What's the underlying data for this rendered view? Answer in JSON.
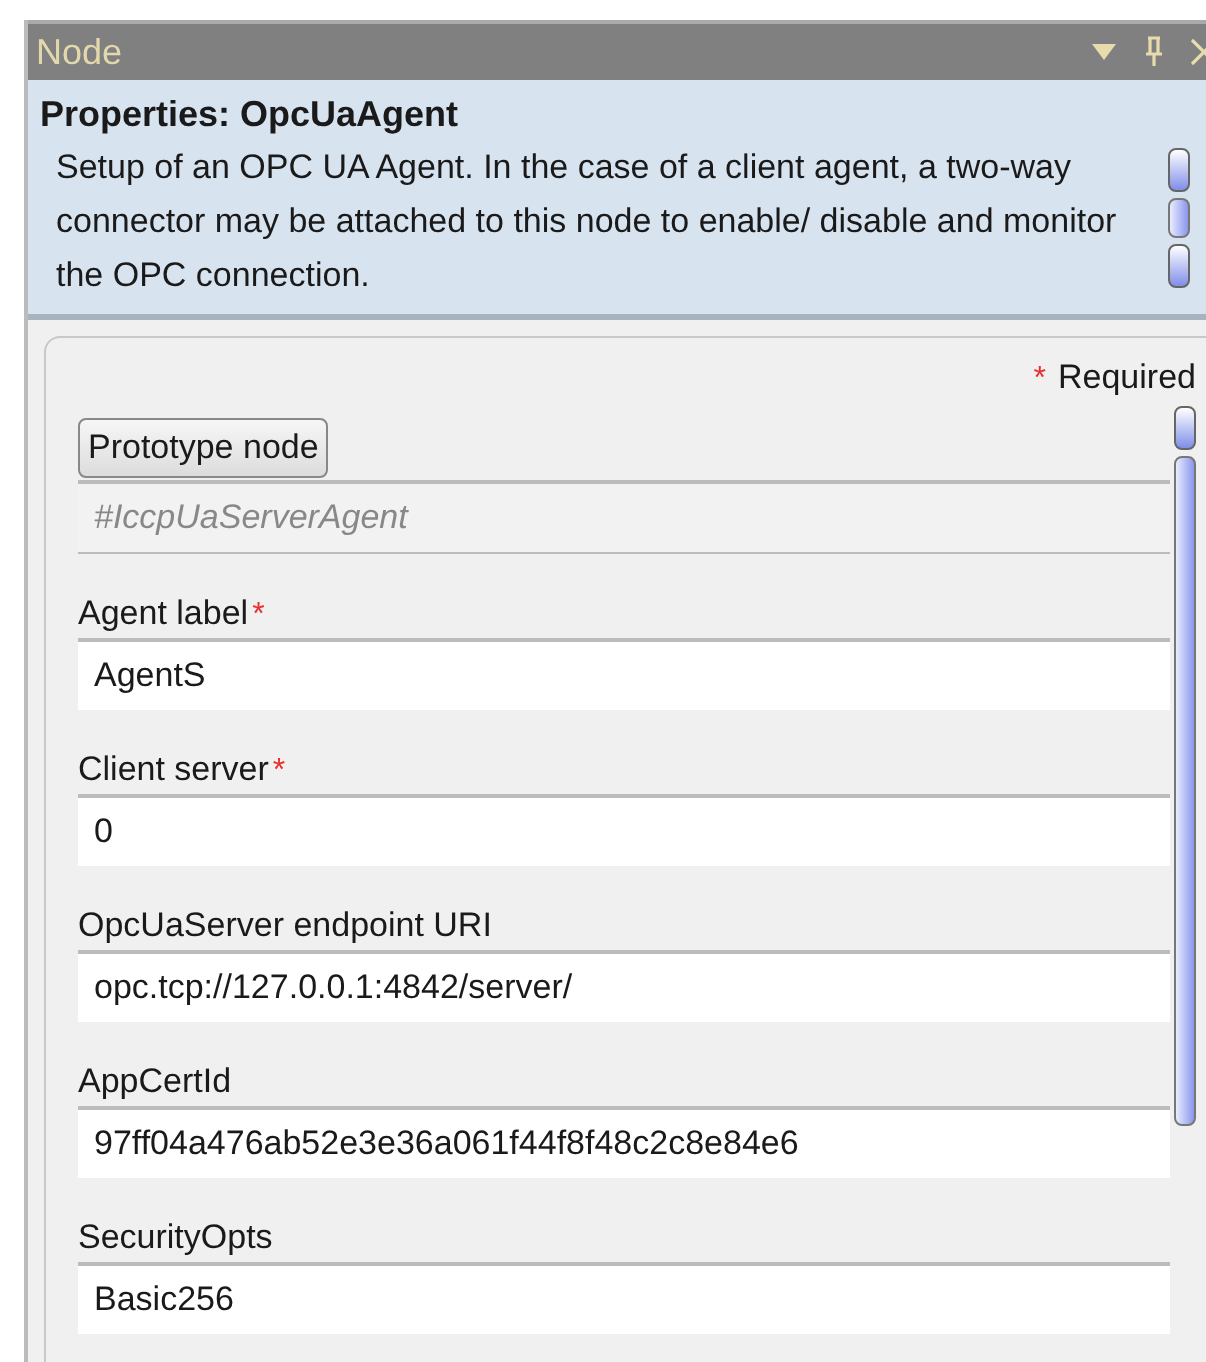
{
  "window": {
    "title": "Node"
  },
  "header": {
    "title": "Properties:  OpcUaAgent",
    "description": "Setup of an OPC UA Agent. In the case of a client agent, a two-way connector may be attached to this node to enable/ disable and monitor the OPC connection."
  },
  "legend": {
    "mark": "*",
    "text": "Required"
  },
  "prototype": {
    "button": "Prototype node",
    "value": "#IccpUaServerAgent"
  },
  "fields": [
    {
      "label": "Agent label",
      "required_mark": "*",
      "value": "AgentS"
    },
    {
      "label": "Client server",
      "required_mark": "*",
      "value": "0"
    },
    {
      "label": "OpcUaServer endpoint URI",
      "value": "opc.tcp://127.0.0.1:4842/server/"
    },
    {
      "label": "AppCertId",
      "value": "97ff04a476ab52e3e36a061f44f8f48c2c8e84e6"
    },
    {
      "label": "SecurityOpts",
      "value": "Basic256"
    }
  ]
}
